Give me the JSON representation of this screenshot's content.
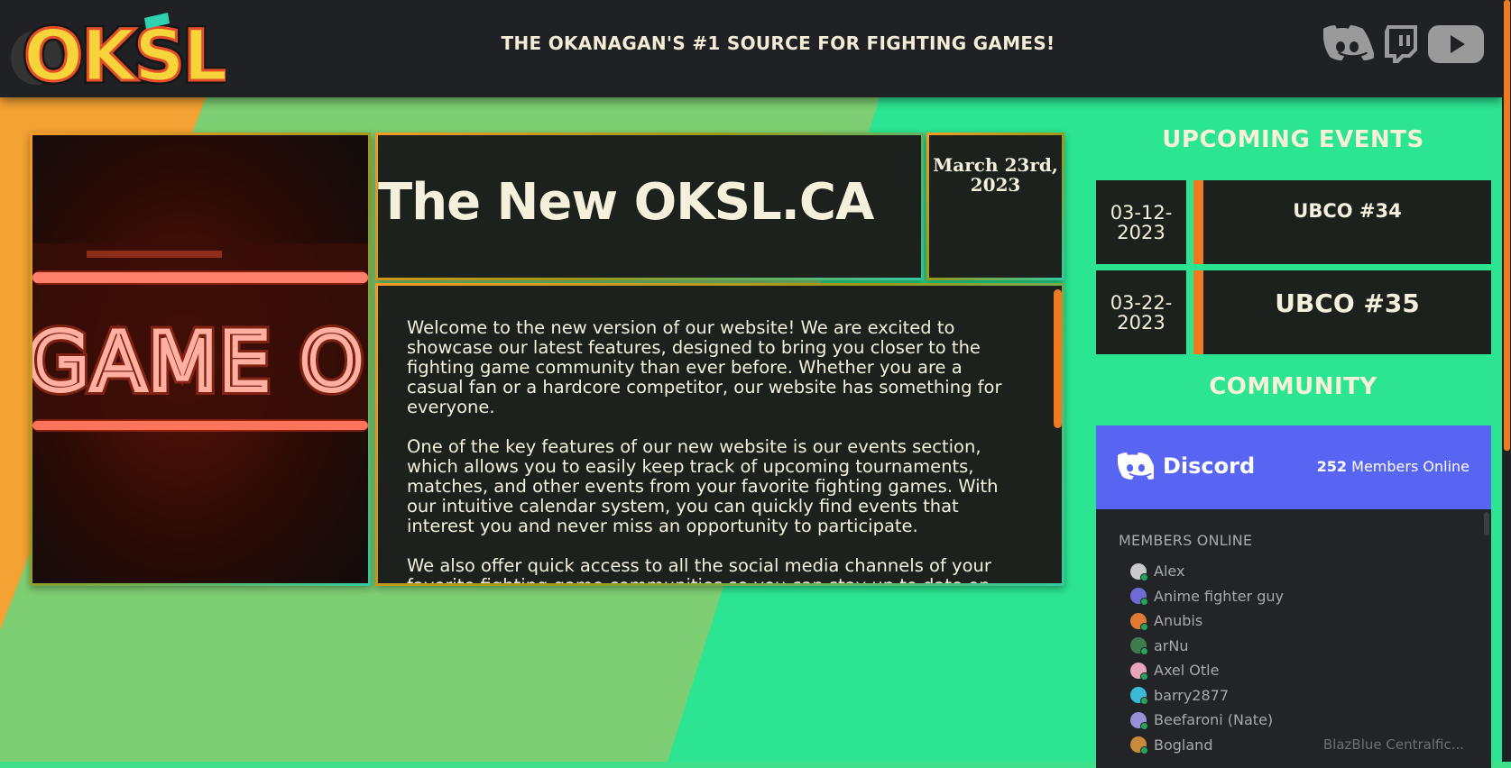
{
  "header": {
    "logo_text": "OKSL",
    "tagline": "THE OKANAGAN'S #1 SOURCE FOR FIGHTING GAMES!",
    "socials": [
      "discord-icon",
      "twitch-icon",
      "youtube-icon"
    ]
  },
  "post": {
    "title": "The New OKSL.CA",
    "date": "March 23rd, 2023",
    "image_sign_text": "GAME O",
    "paragraphs": [
      "Welcome to the new version of our website! We are excited to showcase our latest features, designed to bring you closer to the fighting game community than ever before. Whether you are a casual fan or a hardcore competitor, our website has something for everyone.",
      "One of the key features of our new website is our events section, which allows you to easily keep track of upcoming tournaments, matches, and other events from your favorite fighting games. With our intuitive calendar system, you can quickly find events that interest you and never miss an opportunity to participate.",
      "We also offer quick access to all the social media channels of your favorite fighting game communities so you can stay up to date on the latest"
    ]
  },
  "sidebar": {
    "events_title": "UPCOMING EVENTS",
    "events": [
      {
        "date": "03-12-2023",
        "name": "UBCO #34"
      },
      {
        "date": "03-22-2023",
        "name": "UBCO #35"
      }
    ],
    "community_title": "COMMUNITY"
  },
  "discord": {
    "brand": "Discord",
    "online_count": "252",
    "online_label": "Members Online",
    "section_label": "MEMBERS ONLINE",
    "members": [
      {
        "name": "Alex",
        "game": ""
      },
      {
        "name": "Anime fighter guy",
        "game": ""
      },
      {
        "name": "Anubis",
        "game": ""
      },
      {
        "name": "arNu",
        "game": ""
      },
      {
        "name": "Axel Otle",
        "game": ""
      },
      {
        "name": "barry2877",
        "game": ""
      },
      {
        "name": "Beefaroni (Nate)",
        "game": ""
      },
      {
        "name": "Bogland",
        "game": "BlazBlue Centralfic..."
      }
    ]
  },
  "colors": {
    "accent_orange": "#f07a1f",
    "card_bg": "#1c211e",
    "discord_blurple": "#5865f2",
    "header_bg": "#1f2124",
    "text_cream": "#f4f0dc"
  }
}
